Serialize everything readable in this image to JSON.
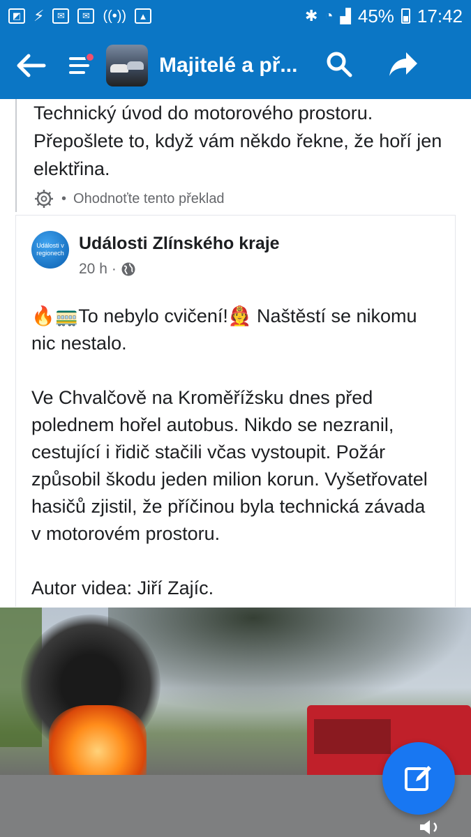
{
  "status_bar": {
    "battery": "45%",
    "time": "17:42",
    "left_icons": [
      "square-icon",
      "signal-arrow-icon",
      "mail-icon",
      "mail-icon",
      "wifi-broadcast-icon",
      "image-icon"
    ],
    "right_icons": [
      "bluetooth-icon",
      "wifi-icon",
      "cell-signal-icon",
      "battery-icon"
    ]
  },
  "app_bar": {
    "title": "Majitelé a př...",
    "icons": [
      "back-arrow-icon",
      "menu-icon",
      "search-icon",
      "share-icon"
    ],
    "color": "#0b76c5"
  },
  "previous_post": {
    "text": "Technický úvod do motorového prostoru. Přepošlete to, když vám někdo řekne, že hoří jen elektřina.",
    "rate_translation": "Ohodnoťte tento překlad"
  },
  "post": {
    "page_name": "Události Zlínského kraje",
    "avatar_text": "Události v regionech",
    "time": "20 h",
    "paragraph1": "🔥🚃To nebylo cvičení!🧑‍🚒 Naštěstí se nikomu nic nestalo.",
    "paragraph2": "Ve Chvalčově na Kroměřížsku dnes před polednem hořel autobus. Nikdo se nezranil, cestující i řidič stačili včas vystoupit. Požár způsobil škodu jeden milion korun. Vyšetřovatel hasičů zjistil, že příčinou byla technická závada v motorovém prostoru.",
    "paragraph3": "Autor videa: Jiří Zajíc."
  },
  "accent_fab": "#1877f2"
}
